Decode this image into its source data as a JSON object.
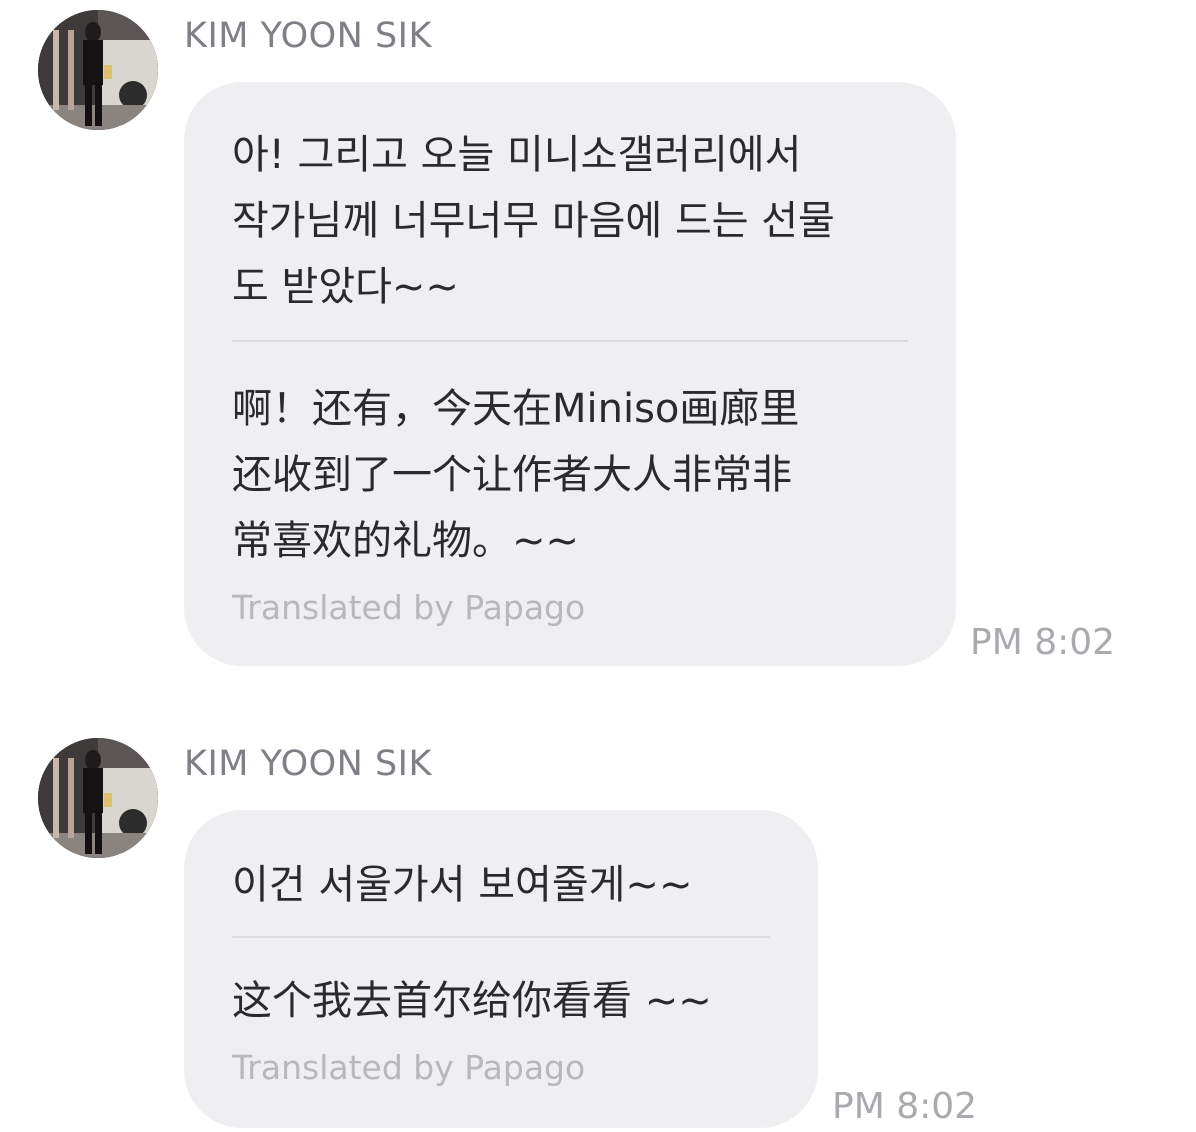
{
  "messages": [
    {
      "sender": "KIM YOON SIK",
      "original": "아! 그리고 오늘 미니소갤러리에서\n작가님께 너무너무 마음에 드는 선물\n도 받았다~~",
      "translation": "啊！还有，今天在Miniso画廊里\n还收到了一个让作者大人非常非\n常喜欢的礼物。~~",
      "translated_by": "Translated by Papago",
      "time": "PM 8:02"
    },
    {
      "sender": "KIM YOON SIK",
      "original": "이건 서울가서 보여줄게~~",
      "translation": "这个我去首尔给你看看 ~~",
      "translated_by": "Translated by Papago",
      "time": "PM 8:02"
    }
  ],
  "avatar_icon": "profile-photo-icon"
}
